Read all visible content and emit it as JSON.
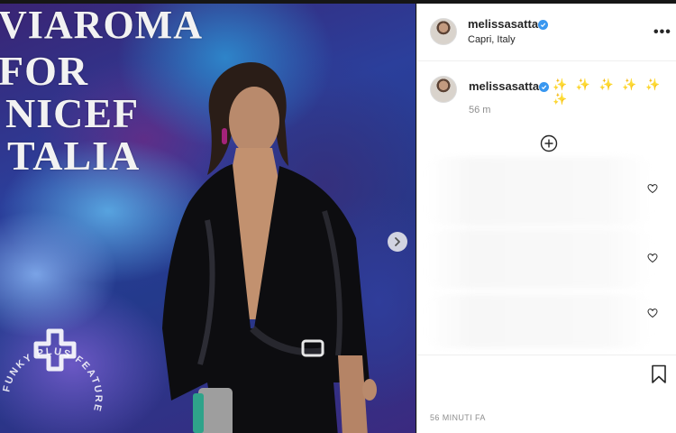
{
  "post": {
    "username": "melissasatta",
    "location": "Capri, Italy",
    "more_label": "•••"
  },
  "photo": {
    "backdrop_lines": [
      "VIAROMA",
      "FOR",
      "NICEF",
      "TALIA"
    ],
    "watermark_text": "FUNKY PLUS FEATURE"
  },
  "caption": {
    "username": "melissasatta",
    "text": "✨ ✨ ✨ ✨ ✨ ✨",
    "time": "56 m"
  },
  "footer": {
    "timestamp": "56 MINUTI FA"
  },
  "colors": {
    "verified": "#3897f0",
    "text_primary": "#262626",
    "text_secondary": "#8e8e8e"
  },
  "icons": {
    "verified": "verified-badge-icon",
    "more": "more-options-icon",
    "next": "chevron-right-icon",
    "load_more": "plus-circle-icon",
    "heart": "heart-icon",
    "bookmark": "bookmark-icon"
  }
}
